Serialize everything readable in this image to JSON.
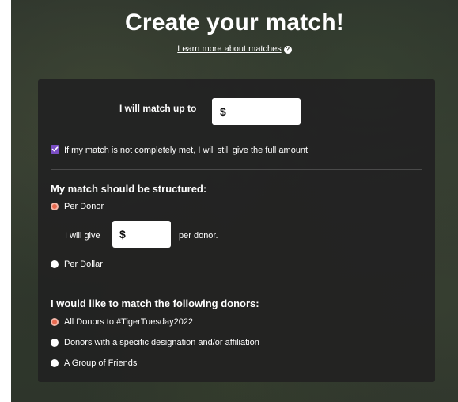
{
  "header": {
    "title": "Create your match!",
    "learn_link": "Learn more about matches",
    "help_icon": "?"
  },
  "match": {
    "up_to_label": "I will match up to",
    "up_to_currency": "$",
    "up_to_value": "",
    "full_amount_checked": true,
    "full_amount_label": "If my match is not completely met, I will still give the full amount"
  },
  "structure": {
    "heading": "My match should be structured:",
    "per_donor_label": "Per Donor",
    "per_donor_selected": true,
    "give_prefix": "I will give",
    "give_currency": "$",
    "give_value": "",
    "give_suffix": "per donor.",
    "per_dollar_label": "Per Dollar",
    "per_dollar_selected": false
  },
  "donors": {
    "heading": "I would like to match the following donors:",
    "options": [
      {
        "label": "All Donors to #TigerTuesday2022",
        "selected": true
      },
      {
        "label": "Donors with a specific designation and/or affiliation",
        "selected": false
      },
      {
        "label": "A Group of Friends",
        "selected": false
      }
    ]
  },
  "colors": {
    "accent_checkbox": "#7a4ec4",
    "accent_radio": "#e8694f",
    "card_bg": "#222222"
  }
}
